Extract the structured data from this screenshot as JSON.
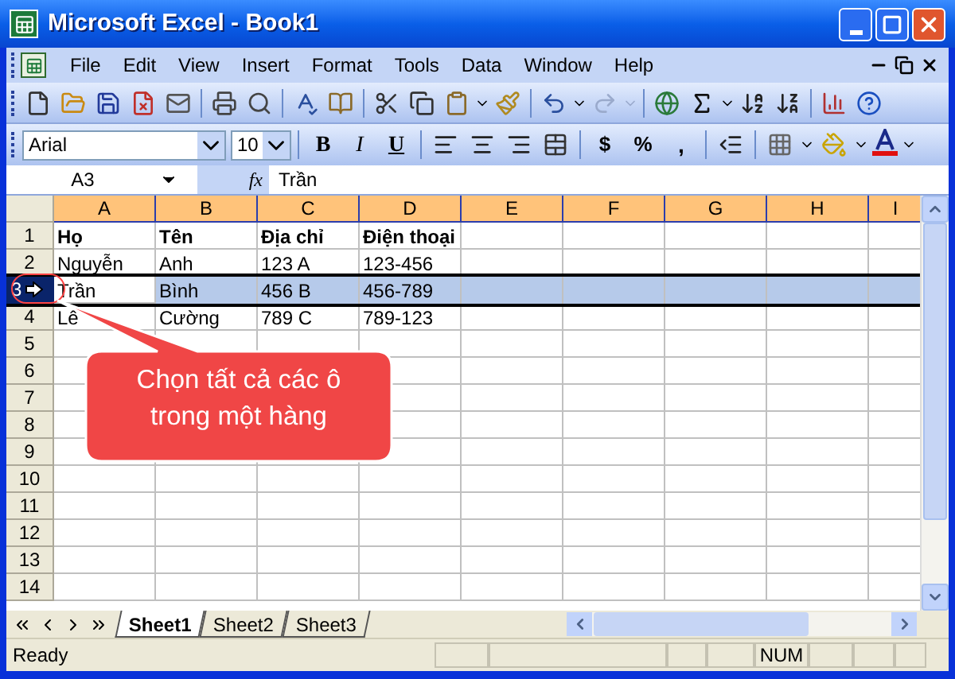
{
  "window": {
    "title": "Microsoft Excel - Book1"
  },
  "menu": [
    "File",
    "Edit",
    "View",
    "Insert",
    "Format",
    "Tools",
    "Data",
    "Window",
    "Help"
  ],
  "format_toolbar": {
    "font": "Arial",
    "size": "10",
    "bold": "B",
    "italic": "I",
    "underline": "U",
    "currency": "$",
    "percent": "%",
    "comma": ","
  },
  "formula_bar": {
    "name_box": "A3",
    "fx": "fx",
    "value": "Trần"
  },
  "columns": [
    "A",
    "B",
    "C",
    "D",
    "E",
    "F",
    "G",
    "H",
    "I"
  ],
  "rows": [
    {
      "header": "1",
      "selected": false,
      "cells": [
        "Họ",
        "Tên",
        "Địa chỉ",
        "Điện thoại"
      ],
      "bold": true
    },
    {
      "header": "2",
      "selected": false,
      "cells": [
        "Nguyễn",
        "Anh",
        "123 A",
        "123-456"
      ],
      "bold": false
    },
    {
      "header": "3",
      "selected": true,
      "cells": [
        "Trần",
        "Bình",
        "456 B",
        "456-789"
      ],
      "bold": false
    },
    {
      "header": "4",
      "selected": false,
      "cells": [
        "Lê",
        "Cường",
        "789 C",
        "789-123"
      ],
      "bold": false
    },
    {
      "header": "5",
      "selected": false
    },
    {
      "header": "6",
      "selected": false
    },
    {
      "header": "7",
      "selected": false
    },
    {
      "header": "8",
      "selected": false
    },
    {
      "header": "9",
      "selected": false
    },
    {
      "header": "10",
      "selected": false
    },
    {
      "header": "11",
      "selected": false
    },
    {
      "header": "12",
      "selected": false
    },
    {
      "header": "13",
      "selected": false
    },
    {
      "header": "14",
      "selected": false
    }
  ],
  "callout": {
    "text": "Chọn tất cả các ô trong một hàng"
  },
  "sheet_tabs": [
    {
      "label": "Sheet1",
      "selected": true
    },
    {
      "label": "Sheet2",
      "selected": false
    },
    {
      "label": "Sheet3",
      "selected": false
    }
  ],
  "status_bar": {
    "text": "Ready",
    "indicator": "NUM"
  }
}
